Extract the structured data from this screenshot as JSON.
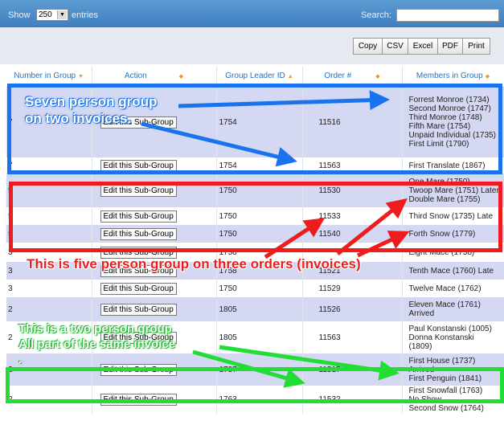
{
  "controls": {
    "show_label": "Show",
    "page_size": "250",
    "entries_label": "entries",
    "search_label": "Search:",
    "search_value": ""
  },
  "toolbar": {
    "copy": "Copy",
    "csv": "CSV",
    "excel": "Excel",
    "pdf": "PDF",
    "print": "Print"
  },
  "columns": {
    "number_in_group": "Number in Group",
    "action": "Action",
    "group_leader_id": "Group Leader ID",
    "order_no": "Order #",
    "members_in_group": "Members in Group"
  },
  "action_label": "Edit this Sub-Group",
  "rows": [
    {
      "num": "7",
      "leader": "1754",
      "order": "11516",
      "members": "Forrest Monroe (1734)\nSecond Monroe (1747)\nThird Monroe (1748)\nFifth Mare (1754)\nUnpaid Individual (1735)\nFirst Limit (1790)"
    },
    {
      "num": "7",
      "leader": "1754",
      "order": "11563",
      "members": "First Translate (1867)"
    },
    {
      "num": "5",
      "leader": "1750",
      "order": "11530",
      "members": "One Mare (1750)\nTwoop Mare (1751) Later\nDouble Mare (1755)"
    },
    {
      "num": "5",
      "leader": "1750",
      "order": "11533",
      "members": "Third Snow (1735) Late"
    },
    {
      "num": "5",
      "leader": "1750",
      "order": "11540",
      "members": "Forth Snow (1779)"
    },
    {
      "num": "3",
      "leader": "1758",
      "order": "",
      "members": "Eight Mace (1758)"
    },
    {
      "num": "3",
      "leader": "1758",
      "order": "11521",
      "members": "Tenth Mace (1760) Late"
    },
    {
      "num": "3",
      "leader": "1750",
      "order": "11529",
      "members": "Twelve Mace (1762)"
    },
    {
      "num": "2",
      "leader": "1805",
      "order": "11526",
      "members": "Eleven Mace (1761)\nArrived"
    },
    {
      "num": "2",
      "leader": "1805",
      "order": "11563",
      "members": "Paul Konstanski (1005)\nDonna Konstanski\n(1809)"
    },
    {
      "num": "2",
      "leader": "1737",
      "order": "11517",
      "members": "First House (1737)\nArrived\nFirst Penguin (1841)"
    },
    {
      "num": "2",
      "leader": "1763",
      "order": "11532",
      "members": "First Snowfall (1763)\nNo Show\nSecond Snow (1764)"
    }
  ],
  "annotations": {
    "blue": "Seven person group\non two invoices.",
    "red": "This is five person group on three orders (invoices)",
    "green": "This is a two person group\nAll part of the same invoice\n."
  },
  "colors": {
    "header_blue": "#4a8ac8",
    "odd_row": "#d4d8f2",
    "annotation_blue": "#1a73ee",
    "annotation_red": "#ee1c1c",
    "annotation_green": "#22dd33",
    "sort_arrow": "#e89a1a"
  }
}
